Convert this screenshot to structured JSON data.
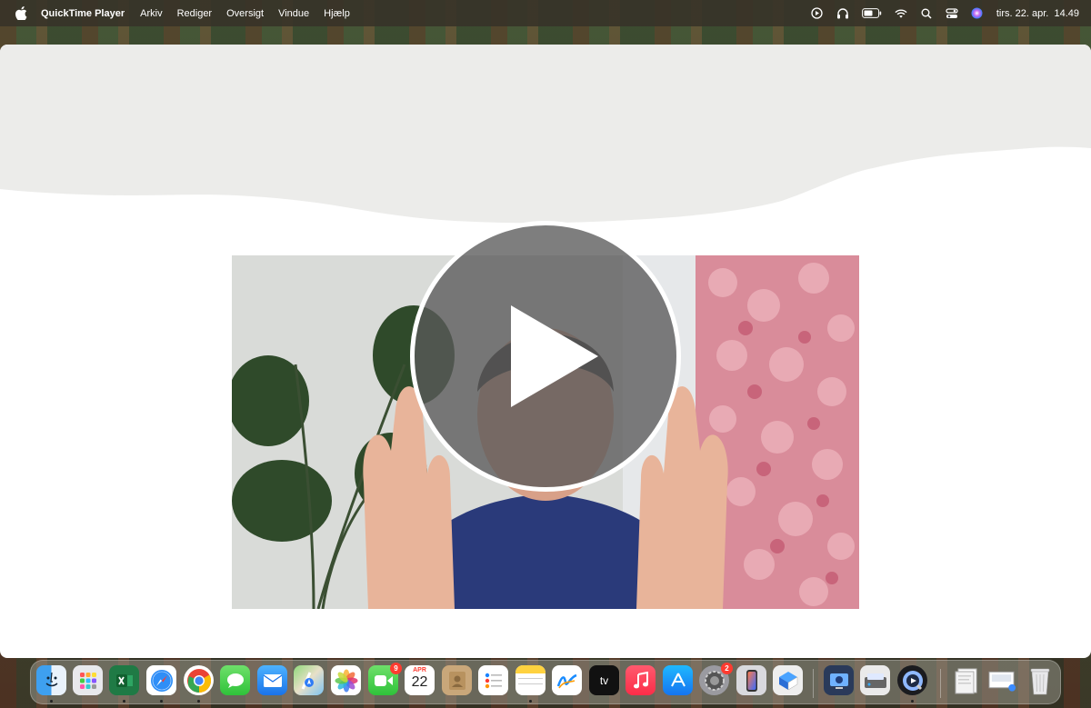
{
  "menubar": {
    "app_name": "QuickTime Player",
    "menus": [
      "Arkiv",
      "Rediger",
      "Oversigt",
      "Vindue",
      "Hjælp"
    ],
    "clock": "tirs. 22. apr.  14.49",
    "status_icons": [
      "play-circle-icon",
      "headphones-icon",
      "battery-icon",
      "wifi-icon",
      "search-icon",
      "control-center-icon",
      "siri-icon"
    ]
  },
  "window": {
    "play_icon": "play-icon",
    "video_subject": "man smiling with raised hands, monstera plant and flower wall"
  },
  "dock": {
    "apps": [
      {
        "name": "finder",
        "running": true
      },
      {
        "name": "launchpad",
        "running": false
      },
      {
        "name": "excel",
        "running": true
      },
      {
        "name": "safari",
        "running": true
      },
      {
        "name": "chrome",
        "running": true
      },
      {
        "name": "messages",
        "running": false
      },
      {
        "name": "mail",
        "running": false
      },
      {
        "name": "maps",
        "running": false
      },
      {
        "name": "photos",
        "running": false
      },
      {
        "name": "facetime",
        "running": false,
        "badge": "9"
      },
      {
        "name": "calendar",
        "running": false,
        "month": "APR",
        "day": "22"
      },
      {
        "name": "contacts",
        "running": false
      },
      {
        "name": "reminders",
        "running": false
      },
      {
        "name": "notes",
        "running": true
      },
      {
        "name": "freeform",
        "running": false
      },
      {
        "name": "apple-tv",
        "running": false,
        "label": "tv"
      },
      {
        "name": "music",
        "running": false
      },
      {
        "name": "app-store",
        "running": false
      },
      {
        "name": "system-settings",
        "running": false,
        "badge": "2"
      },
      {
        "name": "iphone-mirroring",
        "running": false
      },
      {
        "name": "preview",
        "running": false
      },
      {
        "name": "screen-sharing",
        "running": false
      },
      {
        "name": "image-capture",
        "running": false
      },
      {
        "name": "quicktime",
        "running": true
      },
      {
        "name": "downloads-stack",
        "running": false
      },
      {
        "name": "screenshots-stack",
        "running": false
      },
      {
        "name": "trash",
        "running": false
      }
    ]
  }
}
